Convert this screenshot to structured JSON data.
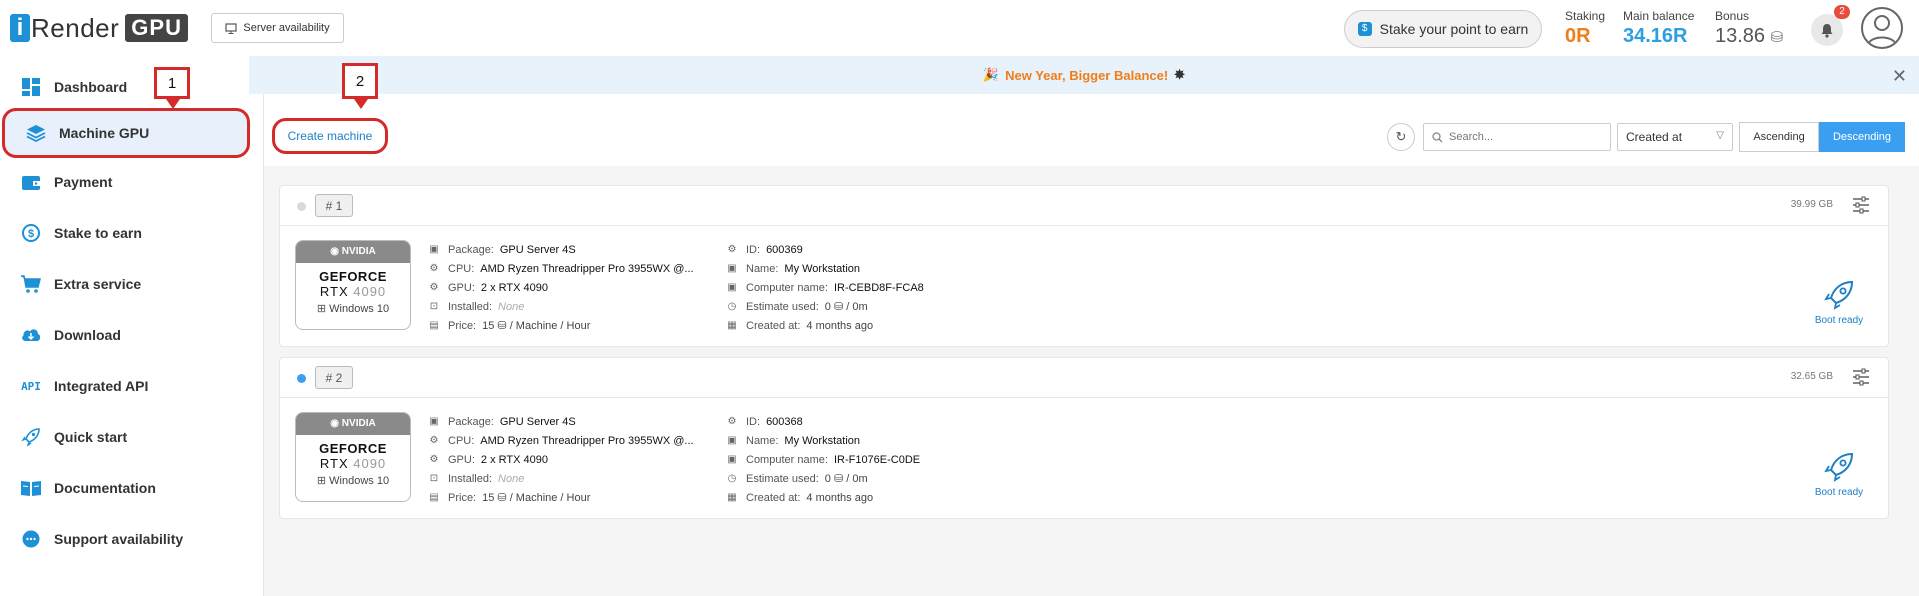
{
  "header": {
    "logo_letter": "i",
    "logo_word": "Render",
    "logo_badge": "GPU",
    "server_button": "Server availability",
    "stake_button": "Stake your point to earn",
    "stats": {
      "staking_label": "Staking",
      "staking_value": "0R",
      "main_label": "Main balance",
      "main_value": "34.16R",
      "bonus_label": "Bonus",
      "bonus_value": "13.86"
    },
    "notification_count": "2"
  },
  "sidebar": {
    "items": [
      {
        "label": "Dashboard",
        "icon": "dashboard-icon"
      },
      {
        "label": "Machine GPU",
        "icon": "layers-icon"
      },
      {
        "label": "Payment",
        "icon": "wallet-icon"
      },
      {
        "label": "Stake to earn",
        "icon": "stake-icon"
      },
      {
        "label": "Extra service",
        "icon": "cart-icon"
      },
      {
        "label": "Download",
        "icon": "cloud-download-icon"
      },
      {
        "label": "Integrated API",
        "icon": "api-icon"
      },
      {
        "label": "Quick start",
        "icon": "rocket-icon"
      },
      {
        "label": "Documentation",
        "icon": "book-icon"
      },
      {
        "label": "Support availability",
        "icon": "chat-icon"
      }
    ]
  },
  "banner": {
    "text": "New Year, Bigger Balance!",
    "close": "✕"
  },
  "toolbar": {
    "create_button": "Create machine",
    "search_placeholder": "Search...",
    "sort_value": "Created at",
    "ascending": "Ascending",
    "descending": "Descending"
  },
  "annotations": {
    "one": "1",
    "two": "2"
  },
  "machines": [
    {
      "number": "# 1",
      "dot_color": "#d9d9d9",
      "size": "39.99 GB",
      "gpu_brand": "NVIDIA",
      "gpu_line1": "GEFORCE",
      "gpu_line2a": "RTX",
      "gpu_line2b": "4090",
      "os": "Windows 10",
      "package_label": "Package:",
      "package": "GPU Server 4S",
      "cpu_label": "CPU:",
      "cpu": "AMD Ryzen Threadripper Pro 3955WX @...",
      "gpu_label": "GPU:",
      "gpu": "2 x RTX 4090",
      "installed_label": "Installed:",
      "installed": "None",
      "price_label": "Price:",
      "price": "15 ⛁ / Machine / Hour",
      "id_label": "ID:",
      "id": "600369",
      "name_label": "Name:",
      "name": "My Workstation",
      "computer_label": "Computer name:",
      "computer": "IR-CEBD8F-FCA8",
      "estimate_label": "Estimate used:",
      "estimate": "0 ⛁  /  0m",
      "created_label": "Created at:",
      "created": "4 months ago",
      "status": "Boot ready"
    },
    {
      "number": "# 2",
      "dot_color": "#3a9ff0",
      "size": "32.65 GB",
      "gpu_brand": "NVIDIA",
      "gpu_line1": "GEFORCE",
      "gpu_line2a": "RTX",
      "gpu_line2b": "4090",
      "os": "Windows 10",
      "package_label": "Package:",
      "package": "GPU Server 4S",
      "cpu_label": "CPU:",
      "cpu": "AMD Ryzen Threadripper Pro 3955WX @...",
      "gpu_label": "GPU:",
      "gpu": "2 x RTX 4090",
      "installed_label": "Installed:",
      "installed": "None",
      "price_label": "Price:",
      "price": "15 ⛁ / Machine / Hour",
      "id_label": "ID:",
      "id": "600368",
      "name_label": "Name:",
      "name": "My Workstation",
      "computer_label": "Computer name:",
      "computer": "IR-F1076E-C0DE",
      "estimate_label": "Estimate used:",
      "estimate": "0 ⛁  /  0m",
      "created_label": "Created at:",
      "created": "4 months ago",
      "status": "Boot ready"
    }
  ]
}
